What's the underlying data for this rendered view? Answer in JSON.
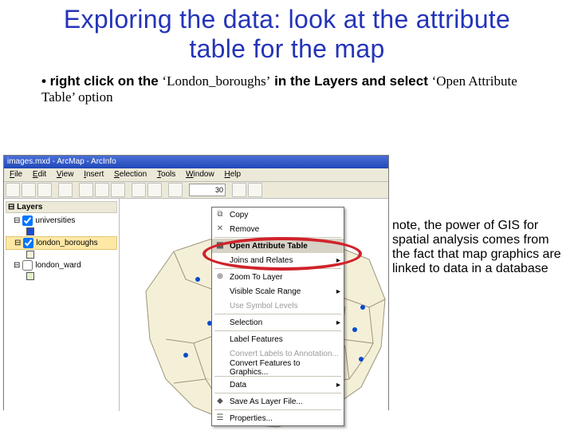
{
  "title": "Exploring the data: look at the attribute table for the map",
  "bullet_prefix": "• right click on the ",
  "bullet_mid": "‘London_boroughs’",
  "bullet_mid2": " in the Layers and select ",
  "bullet_end": "‘Open Attribute Table’ option",
  "note": "note, the power of GIS for spatial analysis comes from the fact that map graphics are linked to data in a database",
  "app": {
    "title": "images.mxd - ArcMap - ArcInfo",
    "menus": [
      "File",
      "Edit",
      "View",
      "Insert",
      "Selection",
      "Tools",
      "Window",
      "Help"
    ],
    "scale": "30",
    "toc_title": "Layers",
    "layers": [
      {
        "name": "universities",
        "checked": true
      },
      {
        "name": "london_boroughs",
        "checked": true,
        "selected": true
      },
      {
        "name": "london_ward",
        "checked": false
      }
    ]
  },
  "ctx": {
    "items": [
      {
        "label": "Copy",
        "icon": "⧉"
      },
      {
        "label": "Remove",
        "icon": "✕"
      },
      {
        "label": "Open Attribute Table",
        "icon": "▦",
        "hl": true
      },
      {
        "label": "Joins and Relates",
        "sub": true
      },
      {
        "label": "Zoom To Layer",
        "icon": "⊕"
      },
      {
        "label": "Visible Scale Range",
        "sub": true
      },
      {
        "label": "Use Symbol Levels",
        "gray": true
      },
      {
        "label": "Selection",
        "sub": true
      },
      {
        "label": "Label Features"
      },
      {
        "label": "Convert Labels to Annotation...",
        "gray": true
      },
      {
        "label": "Convert Features to Graphics..."
      },
      {
        "label": "Data",
        "sub": true
      },
      {
        "label": "Save As Layer File...",
        "icon": "◆"
      },
      {
        "label": "Properties...",
        "icon": "☰"
      }
    ]
  }
}
